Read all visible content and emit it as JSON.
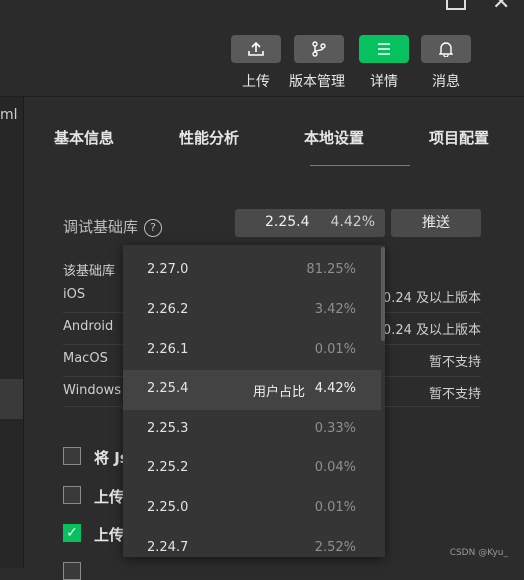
{
  "toolbar": {
    "upload_label": "上传",
    "version_label": "版本管理",
    "details_label": "详情",
    "messages_label": "消息"
  },
  "left_pane": {
    "partial_text": "ml"
  },
  "tabs": [
    "基本信息",
    "性能分析",
    "本地设置",
    "项目配置"
  ],
  "active_tab": "本地设置",
  "debug_lib": {
    "label": "调试基础库",
    "help_glyph": "?",
    "selected_version": "2.25.4",
    "selected_percent": "4.42%",
    "push_label": "推送"
  },
  "compat": {
    "header": "该基础库",
    "rows": [
      {
        "os": "iOS",
        "support": "0.24 及以上版本"
      },
      {
        "os": "Android",
        "support": "0.24 及以上版本"
      },
      {
        "os": "MacOS",
        "support": "暂不支持"
      },
      {
        "os": "Windows",
        "support": "暂不支持"
      }
    ]
  },
  "options": [
    {
      "label": "将 Js",
      "checked": false
    },
    {
      "label": "上传",
      "checked": false
    },
    {
      "label": "上传",
      "checked": true
    }
  ],
  "dropdown": {
    "usage_label": "用户占比",
    "items": [
      {
        "version": "2.27.0",
        "percent": "81.25%"
      },
      {
        "version": "2.26.2",
        "percent": "3.42%"
      },
      {
        "version": "2.26.1",
        "percent": "0.01%"
      },
      {
        "version": "2.25.4",
        "percent": "4.42%",
        "highlighted": true
      },
      {
        "version": "2.25.3",
        "percent": "0.33%"
      },
      {
        "version": "2.25.2",
        "percent": "0.04%"
      },
      {
        "version": "2.25.0",
        "percent": "0.01%"
      },
      {
        "version": "2.24.7",
        "percent": "2.52%"
      }
    ]
  },
  "watermark": "CSDN @Kyu_",
  "colors": {
    "accent": "#07c160",
    "background": "#2c2c2c",
    "dropdown": "#353535"
  }
}
